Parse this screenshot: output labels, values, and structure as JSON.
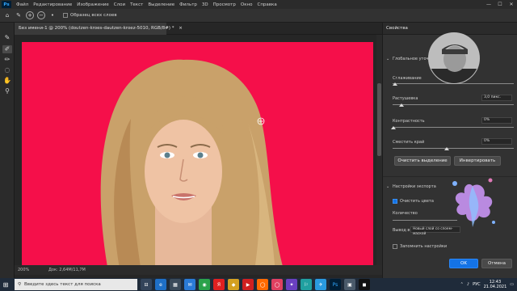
{
  "app": {
    "logo": "Ps"
  },
  "menu": [
    "Файл",
    "Редактирование",
    "Изображение",
    "Слои",
    "Текст",
    "Выделение",
    "Фильтр",
    "3D",
    "Просмотр",
    "Окно",
    "Справка"
  ],
  "window_controls": [
    "—",
    "☐",
    "✕"
  ],
  "options_bar": {
    "sample_all_layers": "Образец всех слоев"
  },
  "document": {
    "tab_title": "Без имени-1 @ 200% (doutzen-kroes-dautzen-kroez-5010, RGB/8#) *",
    "tab_close": "×",
    "zoom": "200%",
    "doc_info": "Док: 2,64М/11,7М"
  },
  "colors": {
    "canvas_bg": "#f50f4a",
    "accent_button": "#1473e6"
  },
  "properties": {
    "panel_title": "Свойства",
    "global_refinements": "Глобальное уточнен...",
    "smooth": {
      "label": "Сглаживание",
      "value": ""
    },
    "feather": {
      "label": "Растушевка",
      "value": "3,0 пикс."
    },
    "contrast": {
      "label": "Контрастность",
      "value": "0%"
    },
    "shift_edge": {
      "label": "Сместить край",
      "value": "0%"
    },
    "clear_selection": "Очистить выделение",
    "invert": "Инвертировать",
    "output_settings": "Настройки экспорта",
    "decontaminate": "Очистить цвета",
    "amount": "Количество",
    "output_to_label": "Вывод в:",
    "output_to_value": "Новый слой со слоем-маской",
    "remember": "Запомнить настройки",
    "ok": "OK",
    "cancel": "Отмена"
  },
  "taskbar": {
    "search_placeholder": "Введите здесь текст для поиска",
    "apps": [
      "⊟",
      "e",
      "▦",
      "✉",
      "◉",
      "Я",
      "◆",
      "▶",
      "◯",
      "◯",
      "✦",
      "⚐",
      "✈",
      "Ps",
      "▣",
      "◼"
    ],
    "lang": "РУС",
    "time": "12:43",
    "date": "21.04.2021"
  }
}
